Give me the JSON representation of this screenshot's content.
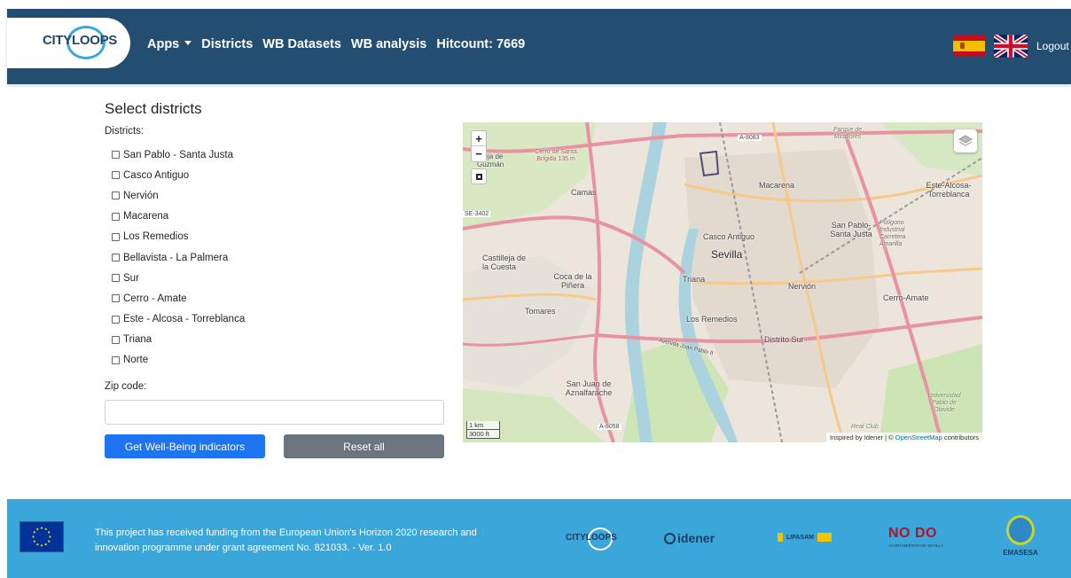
{
  "navbar": {
    "logo_text": "CITYLOOPS",
    "apps_label": "Apps",
    "districts_label": "Districts",
    "wb_datasets_label": "WB Datasets",
    "wb_analysis_label": "WB analysis",
    "hitcount_label": "Hitcount: 7669",
    "logout_label": "Logout"
  },
  "form": {
    "title": "Select districts",
    "districts_label": "Districts:",
    "districts": [
      "San Pablo - Santa Justa",
      "Casco Antiguo",
      "Nervión",
      "Macarena",
      "Los Remedios",
      "Bellavista - La Palmera",
      "Sur",
      "Cerro - Amate",
      "Este - Alcosa - Torreblanca",
      "Triana",
      "Norte"
    ],
    "zip_label": "Zip code:",
    "zip_value": "",
    "submit_label": "Get Well-Being indicators",
    "reset_label": "Reset all"
  },
  "map": {
    "zoom_in": "+",
    "zoom_out": "−",
    "labels": {
      "sevilla": "Sevilla",
      "macarena": "Macarena",
      "casco_antiguo": "Casco Antiguo",
      "triana": "Triana",
      "nervion": "Nervión",
      "los_remedios": "Los Remedios",
      "distrito_sur": "Distrito Sur",
      "cerro_amate": "Cerro-Amate",
      "san_pablo_santa_justa": "San Pablo-Santa Justa",
      "este_alcosa_torreblanca": "Este-Alcosa-Torreblanca",
      "camas": "Camas",
      "castilleja_cuesta": "Castilleja de la Cuesta",
      "coca_pinera": "Coca de la Piñera",
      "tomares": "Tomares",
      "san_juan_aznalfarache": "San Juan de Aznalfarache",
      "castilleja_guzman": "tilleja de Guzmán",
      "cerro_santa_brigida": "Cerro de Santa Brígida 135 m",
      "parque_miraflores": "Parque de Miraflores",
      "poligono": "Polígono Industrial Carretera Amarilla",
      "universidad": "Universidad Pablo de Olavide",
      "real_club": "Real Club",
      "a8083": "A-8083",
      "se3402": "SE-3402",
      "a8058": "A-8058",
      "avenida": "Avenida Juan Pablo II"
    },
    "scale_km": "1 km",
    "scale_ft": "3000 ft",
    "attribution_prefix": "Inspired by Idener | ©",
    "attribution_osm": "OpenStreetMap",
    "attribution_suffix": "contributors"
  },
  "footer": {
    "funding_text": "This project has received funding from the European Union's Horizon 2020 research and innovation programme under grant agreement No. 821033. - Ver. 1.0",
    "logos": {
      "cityloops": "CITYLOOPS",
      "idener": "idener",
      "lipasam": "LIPASAM",
      "nodo": "NO DO",
      "nodo_sub": "AYUNTAMIENTO DE SEVILLA",
      "emasesa": "EMASESA"
    }
  },
  "colors": {
    "navbar": "#234e72",
    "footer": "#3ba6d9",
    "primary_button": "#1e73f0",
    "secondary_button": "#6c757d"
  }
}
